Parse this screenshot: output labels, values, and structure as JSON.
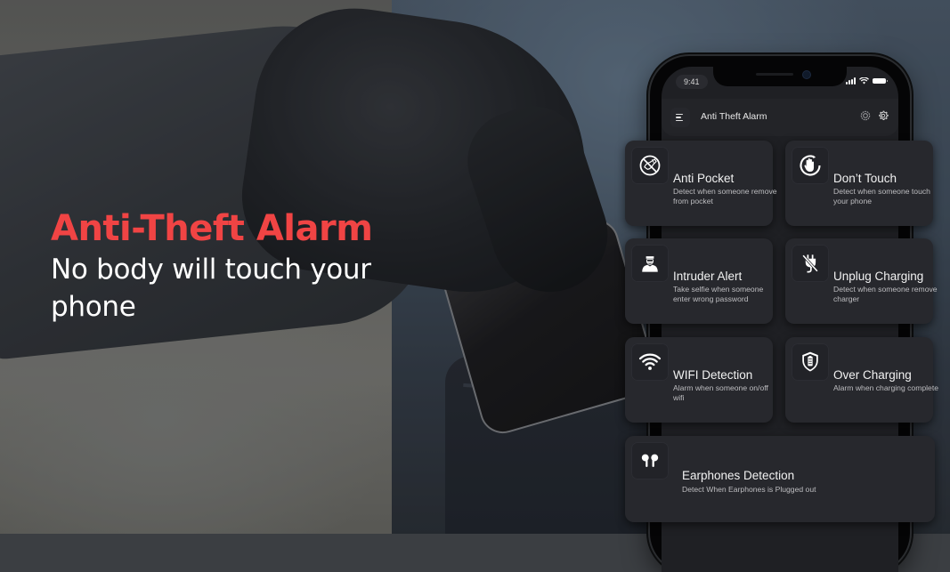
{
  "headline": {
    "title": "Anti-Theft Alarm",
    "subtitle": "No body will touch your phone",
    "title_color": "#f04444"
  },
  "phone": {
    "status_bar": {
      "time": "9:41",
      "icons": [
        "signal-icon",
        "wifi-icon",
        "battery-icon"
      ]
    },
    "app_header": {
      "menu_icon": "hamburger-menu-icon",
      "title": "Anti Theft Alarm",
      "actions": [
        "gear-badge-icon",
        "settings-gear-icon"
      ]
    }
  },
  "features": [
    {
      "id": "anti-pocket",
      "icon": "no-pocket-icon",
      "title": "Anti Pocket",
      "description": "Detect when someone remove from pocket"
    },
    {
      "id": "dont-touch",
      "icon": "stop-hand-icon",
      "title": "Don’t Touch",
      "description": "Detect when someone touch your phone"
    },
    {
      "id": "intruder-alert",
      "icon": "intruder-icon",
      "title": "Intruder Alert",
      "description": "Take selfie when someone enter wrong password"
    },
    {
      "id": "unplug-charging",
      "icon": "unplug-icon",
      "title": "Unplug Charging",
      "description": "Detect when someone remove charger"
    },
    {
      "id": "wifi-detection",
      "icon": "wifi-icon",
      "title": "WIFI Detection",
      "description": "Alarm when someone on/off wifi"
    },
    {
      "id": "over-charging",
      "icon": "battery-shield-icon",
      "title": "Over Charging",
      "description": "Alarm when charging complete"
    },
    {
      "id": "earphones-detection",
      "icon": "earbuds-icon",
      "title": "Earphones Detection",
      "description": "Detect When Earphones is Plugged out"
    }
  ],
  "colors": {
    "card_bg": "#27282d",
    "screen_bg": "#1f2024",
    "accent_red": "#f04444",
    "text_primary": "#f2f2f2",
    "text_secondary": "#bdbdc0"
  }
}
